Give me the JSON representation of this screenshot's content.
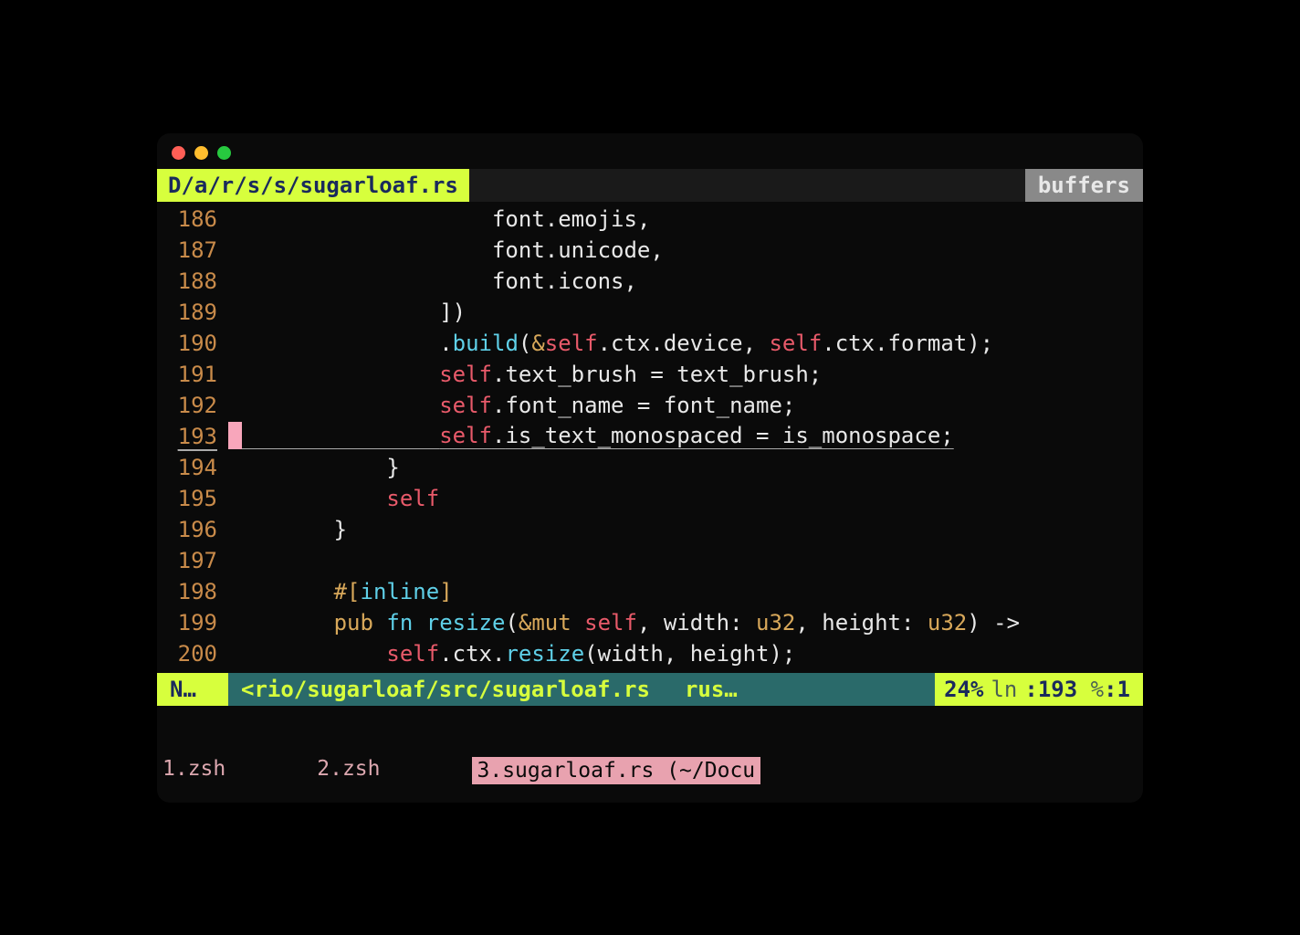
{
  "header": {
    "path": "D/a/r/s/s/sugarloaf.rs",
    "buffers_label": "buffers"
  },
  "lines": [
    {
      "num": "186",
      "indent": "                    ",
      "tokens": [
        [
          "font",
          "default"
        ],
        [
          ".",
          "punct"
        ],
        [
          "emojis",
          "default"
        ],
        [
          ",",
          "punct"
        ]
      ]
    },
    {
      "num": "187",
      "indent": "                    ",
      "tokens": [
        [
          "font",
          "default"
        ],
        [
          ".",
          "punct"
        ],
        [
          "unicode",
          "default"
        ],
        [
          ",",
          "punct"
        ]
      ]
    },
    {
      "num": "188",
      "indent": "                    ",
      "tokens": [
        [
          "font",
          "default"
        ],
        [
          ".",
          "punct"
        ],
        [
          "icons",
          "default"
        ],
        [
          ",",
          "punct"
        ]
      ]
    },
    {
      "num": "189",
      "indent": "                ",
      "tokens": [
        [
          "])",
          "punct"
        ]
      ]
    },
    {
      "num": "190",
      "indent": "                ",
      "tokens": [
        [
          ".",
          "punct"
        ],
        [
          "build",
          "fn"
        ],
        [
          "(",
          "punct"
        ],
        [
          "&",
          "amp"
        ],
        [
          "self",
          "self"
        ],
        [
          ".",
          "punct"
        ],
        [
          "ctx",
          "default"
        ],
        [
          ".",
          "punct"
        ],
        [
          "device",
          "default"
        ],
        [
          ", ",
          "punct"
        ],
        [
          "self",
          "self"
        ],
        [
          ".",
          "punct"
        ],
        [
          "ctx",
          "default"
        ],
        [
          ".",
          "punct"
        ],
        [
          "format",
          "default"
        ],
        [
          ");",
          "punct"
        ]
      ]
    },
    {
      "num": "191",
      "indent": "                ",
      "tokens": [
        [
          "self",
          "self"
        ],
        [
          ".",
          "punct"
        ],
        [
          "text_brush",
          "default"
        ],
        [
          " = ",
          "punct"
        ],
        [
          "text_brush",
          "default"
        ],
        [
          ";",
          "punct"
        ]
      ]
    },
    {
      "num": "192",
      "indent": "                ",
      "tokens": [
        [
          "self",
          "self"
        ],
        [
          ".",
          "punct"
        ],
        [
          "font_name",
          "default"
        ],
        [
          " = ",
          "punct"
        ],
        [
          "font_name",
          "default"
        ],
        [
          ";",
          "punct"
        ]
      ]
    },
    {
      "num": "193",
      "indent": "                ",
      "current": true,
      "cursor": true,
      "tokens": [
        [
          "self",
          "self"
        ],
        [
          ".",
          "punct"
        ],
        [
          "is_text_monospaced",
          "default"
        ],
        [
          " = ",
          "punct"
        ],
        [
          "is_monospace",
          "default"
        ],
        [
          ";",
          "punct"
        ]
      ]
    },
    {
      "num": "194",
      "indent": "            ",
      "tokens": [
        [
          "}",
          "punct"
        ]
      ]
    },
    {
      "num": "195",
      "indent": "            ",
      "tokens": [
        [
          "self",
          "self"
        ]
      ]
    },
    {
      "num": "196",
      "indent": "        ",
      "tokens": [
        [
          "}",
          "punct"
        ]
      ]
    },
    {
      "num": "197",
      "indent": "",
      "tokens": []
    },
    {
      "num": "198",
      "indent": "        ",
      "tokens": [
        [
          "#[",
          "amber"
        ],
        [
          "inline",
          "attr"
        ],
        [
          "]",
          "amber"
        ]
      ]
    },
    {
      "num": "199",
      "indent": "        ",
      "tokens": [
        [
          "pub ",
          "kw-pub"
        ],
        [
          "fn ",
          "kw-fn"
        ],
        [
          "resize",
          "fn"
        ],
        [
          "(",
          "punct"
        ],
        [
          "&mut ",
          "amp"
        ],
        [
          "self",
          "self"
        ],
        [
          ", ",
          "punct"
        ],
        [
          "width",
          "param"
        ],
        [
          ": ",
          "punct"
        ],
        [
          "u32",
          "type"
        ],
        [
          ", ",
          "punct"
        ],
        [
          "height",
          "param"
        ],
        [
          ": ",
          "punct"
        ],
        [
          "u32",
          "type"
        ],
        [
          ") ->",
          "punct"
        ]
      ]
    },
    {
      "num": "200",
      "indent": "            ",
      "tokens": [
        [
          "self",
          "self"
        ],
        [
          ".",
          "punct"
        ],
        [
          "ctx",
          "default"
        ],
        [
          ".",
          "punct"
        ],
        [
          "resize",
          "fn"
        ],
        [
          "(",
          "punct"
        ],
        [
          "width",
          "default"
        ],
        [
          ", ",
          "punct"
        ],
        [
          "height",
          "default"
        ],
        [
          ");",
          "punct"
        ]
      ]
    }
  ],
  "status": {
    "mode": "N…",
    "path": "<rio/sugarloaf/src/sugarloaf.rs",
    "filetype": "rus…",
    "percent": "24%",
    "ln_label": "ln",
    "ln_value": ":193",
    "col_label": "%",
    "col_value": ":1"
  },
  "tabs": [
    {
      "label": "1.zsh",
      "active": false
    },
    {
      "label": "2.zsh",
      "active": false
    },
    {
      "label": "3.sugarloaf.rs (~/Docu",
      "active": true
    }
  ]
}
